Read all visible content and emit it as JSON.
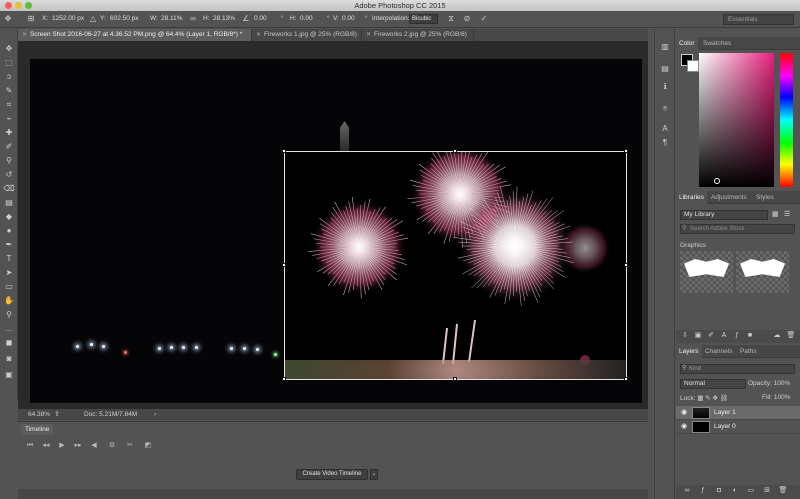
{
  "app": {
    "title": "Adobe Photoshop CC 2015"
  },
  "options_bar": {
    "x_label": "X:",
    "x_value": "1252.00 px",
    "y_label": "Y:",
    "y_value": "602.50 px",
    "w_label": "W:",
    "w_value": "28.11%",
    "h_label": "H:",
    "h_value": "28.13%",
    "rotate_value": "0.00",
    "rotate_unit": "°",
    "hskew_label": "H:",
    "hskew_value": "0.00",
    "hskew_unit": "°",
    "vskew_label": "V:",
    "vskew_value": "0.00",
    "vskew_unit": "°",
    "interp_label": "Interpolation:",
    "interp_value": "Bicubic",
    "workspace": "Essentials"
  },
  "doc_tabs": [
    {
      "label": "Screen Shot 2016-06-27 at 4.36.52 PM.png @ 64.4% (Layer 1, RGB/8*) *",
      "active": true
    },
    {
      "label": "Fireworks 1.jpg @ 25% (RGB/8)",
      "active": false
    },
    {
      "label": "Fireworks 2.jpg @ 25% (RGB/8)",
      "active": false
    }
  ],
  "status": {
    "zoom": "64.38%",
    "doc_info": "Doc: 5.21M/7.84M"
  },
  "timeline": {
    "tab_label": "Timeline",
    "create_button": "Create Video Timeline"
  },
  "color_panel": {
    "tabs": [
      "Color",
      "Swatches"
    ],
    "foreground_color": "#000000",
    "background_color": "#ffffff",
    "hue_color": "#e8207c"
  },
  "libraries_panel": {
    "tabs": [
      "Libraries",
      "Adjustments",
      "Styles"
    ],
    "library_select": "My Library",
    "search_placeholder": "Search Adobe Stock",
    "section_label": "Graphics"
  },
  "layers_panel": {
    "tabs": [
      "Layers",
      "Channels",
      "Paths"
    ],
    "filter_label": "Kind",
    "blend_mode": "Normal",
    "opacity_label": "Opacity:",
    "opacity_value": "100%",
    "lock_label": "Lock:",
    "fill_label": "Fill:",
    "fill_value": "100%",
    "layers": [
      {
        "name": "Layer 1",
        "selected": true
      },
      {
        "name": "Layer 0",
        "selected": false
      }
    ]
  },
  "icons": {
    "eye": "visibility-icon",
    "arrow_down": "chevron-down-icon",
    "search": "search-icon"
  }
}
